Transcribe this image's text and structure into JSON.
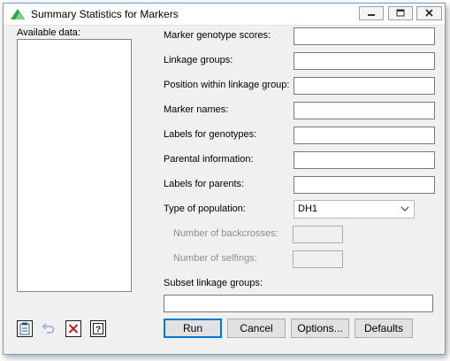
{
  "window": {
    "title": "Summary Statistics for Markers"
  },
  "left_panel": {
    "available_data_label": "Available data:"
  },
  "fields": {
    "marker_genotype_scores": {
      "label": "Marker genotype scores:",
      "value": ""
    },
    "linkage_groups": {
      "label": "Linkage groups:",
      "value": ""
    },
    "position_within_linkage_group": {
      "label": "Position within linkage group:",
      "value": ""
    },
    "marker_names": {
      "label": "Marker names:",
      "value": ""
    },
    "labels_for_genotypes": {
      "label": "Labels for genotypes:",
      "value": ""
    },
    "parental_information": {
      "label": "Parental information:",
      "value": ""
    },
    "labels_for_parents": {
      "label": "Labels for parents:",
      "value": ""
    }
  },
  "type_of_population": {
    "label": "Type of population:",
    "selected": "DH1"
  },
  "number_of_backcrosses": {
    "label": "Number of backcrosses:",
    "value": ""
  },
  "number_of_selfings": {
    "label": "Number of selfings:",
    "value": ""
  },
  "subset_linkage_groups": {
    "label": "Subset linkage groups:",
    "value": ""
  },
  "buttons": {
    "run": "Run",
    "cancel": "Cancel",
    "options": "Options...",
    "defaults": "Defaults"
  },
  "icons": [
    "app-icon",
    "minimize-icon",
    "maximize-icon",
    "close-icon",
    "clipboard-icon",
    "undo-icon",
    "clear-icon",
    "help-icon"
  ],
  "colors": {
    "window_bg": "#f0f0f0",
    "default_button_border": "#0078d7",
    "disabled_text": "#8e8e8e"
  }
}
